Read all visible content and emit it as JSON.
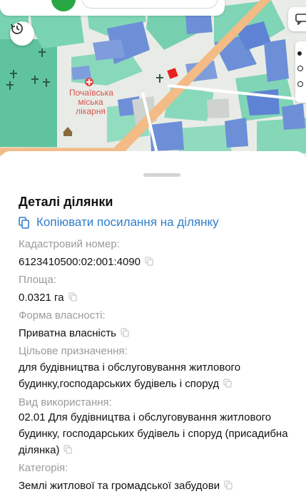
{
  "map": {
    "label_hospital": [
      "Почаївська",
      "міська",
      "лікарня"
    ]
  },
  "details": {
    "title": "Деталі ділянки",
    "copy_link_label": "Копіювати посилання на ділянку",
    "cadastral_label": "Кадастровий номер:",
    "cadastral_value": "6123410500:02:001:4090",
    "area_label": "Площа:",
    "area_value": "0.0321 га",
    "ownership_label": "Форма власності:",
    "ownership_value": "Приватна власність",
    "purpose_label": "Цільове призначення:",
    "purpose_lines": [
      "для будівництва і обслуговування житлового",
      "будинку,господарських будівель і споруд"
    ],
    "usage_label": "Вид використання:",
    "usage_lines": [
      "02.01 Для будівництва і обслуговування житлового",
      "будинку, господарських будівель і споруд (присадибна",
      "ділянка)"
    ],
    "category_label": "Категорія:",
    "category_value": "Землі житлової та громадської забудови"
  },
  "colors": {
    "accent": "#2f7ec9",
    "map_green": "#6fcfae",
    "building_blue": "#6d8fd8",
    "road": "#f5c08a",
    "selected_parcel": "#e8201f",
    "action_green": "#29a745"
  },
  "icons": [
    "search-bar",
    "history-icon",
    "layers-icon",
    "copy-icon",
    "hospital-icon",
    "church-icon"
  ]
}
